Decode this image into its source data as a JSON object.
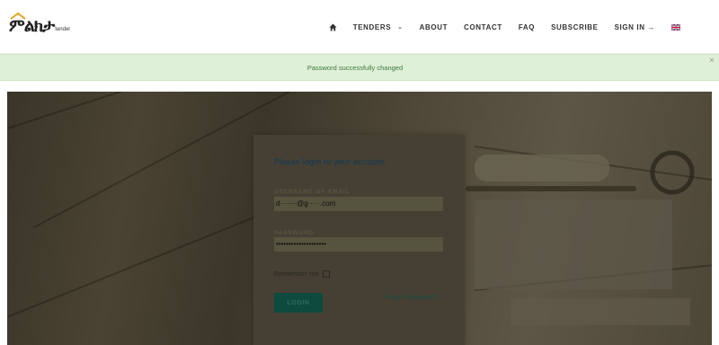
{
  "brand": {
    "logo_text": "ምልክታ",
    "logo_sup": "tender"
  },
  "nav": {
    "home_icon": "home-icon",
    "tenders": "TENDERS",
    "about": "ABOUT",
    "contact": "CONTACT",
    "faq": "FAQ",
    "subscribe": "SUBSCRIBE",
    "sign_in": "SIGN IN →",
    "language_flag": "uk-flag-icon"
  },
  "alert": {
    "message": "Password successfully changed",
    "close": "×"
  },
  "login": {
    "title": "Please login to your account.",
    "username_label": "USERNAME OR EMAIL",
    "username_value": "d·······@g·····.com",
    "password_label": "PASSWORD",
    "password_value": "••••••••••••••••••••",
    "remember_label": "Remember me",
    "login_button": "LOGIN",
    "forgot_link": "Forgot Password?"
  },
  "colors": {
    "alert_bg": "#dff0d8",
    "alert_text": "#3c763d",
    "button": "#0f4a3e",
    "logo_accent": "#e8a21a"
  }
}
